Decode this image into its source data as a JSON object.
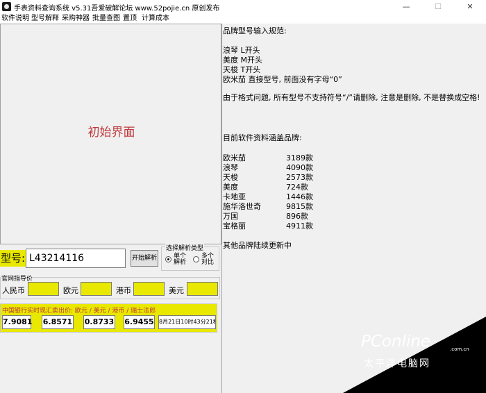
{
  "window": {
    "title": "手表资料查询系统 v5.31吾爱破解论坛 www.52pojie.cn 原创发布",
    "minimize": "—",
    "maximize": "☐",
    "close": "✕"
  },
  "menu": [
    "软件说明",
    "型号解释",
    "采购神器",
    "批量查图",
    "置顶",
    "计算成本"
  ],
  "preview": {
    "text": "初始界面"
  },
  "info": {
    "heading": "品牌型号输入规范:",
    "rules": [
      "浪琴  L开头",
      "美度  M开头",
      "天梭  T开头",
      "欧米茄  直接型号, 前面没有字母“0”"
    ],
    "note": "由于格式问题, 所有型号不支持符号“/”请删除, 注意是删除, 不是替换成空格!",
    "brands_heading": "目前软件资料涵盖品牌:",
    "brands": [
      {
        "name": "欧米茄",
        "count": "3189款"
      },
      {
        "name": "浪琴",
        "count": "4090款"
      },
      {
        "name": "天梭",
        "count": "2573款"
      },
      {
        "name": "美度",
        "count": "724款"
      },
      {
        "name": "卡地亚",
        "count": "1446款"
      },
      {
        "name": "施华洛世奇",
        "count": "9815款"
      },
      {
        "name": "万国",
        "count": "896款"
      },
      {
        "name": "宝格丽",
        "count": "4911款"
      }
    ],
    "footer": "其他品牌陆续更新中"
  },
  "search": {
    "label": "型号:",
    "value": "L43214116",
    "button": "开始解析"
  },
  "parse_type": {
    "title": "选择解析类型",
    "single": "单个解析",
    "multi": "多个对比",
    "selected": "single"
  },
  "official_price": {
    "title": "官网指导价",
    "currencies": [
      "人民币",
      "欧元",
      "港币",
      "美元"
    ]
  },
  "exchange": {
    "title": "中国银行实时现汇卖出价: 欧元 / 美元 / 港币 / 瑞士法郎",
    "rates": [
      "7.9081",
      "6.8571",
      "0.8733",
      "6.9455"
    ],
    "time": "8月21日10时43分21秒"
  },
  "watermark": {
    "logo": "PConline",
    "domain": ".com.cn",
    "cn": "太平洋电脑网"
  }
}
